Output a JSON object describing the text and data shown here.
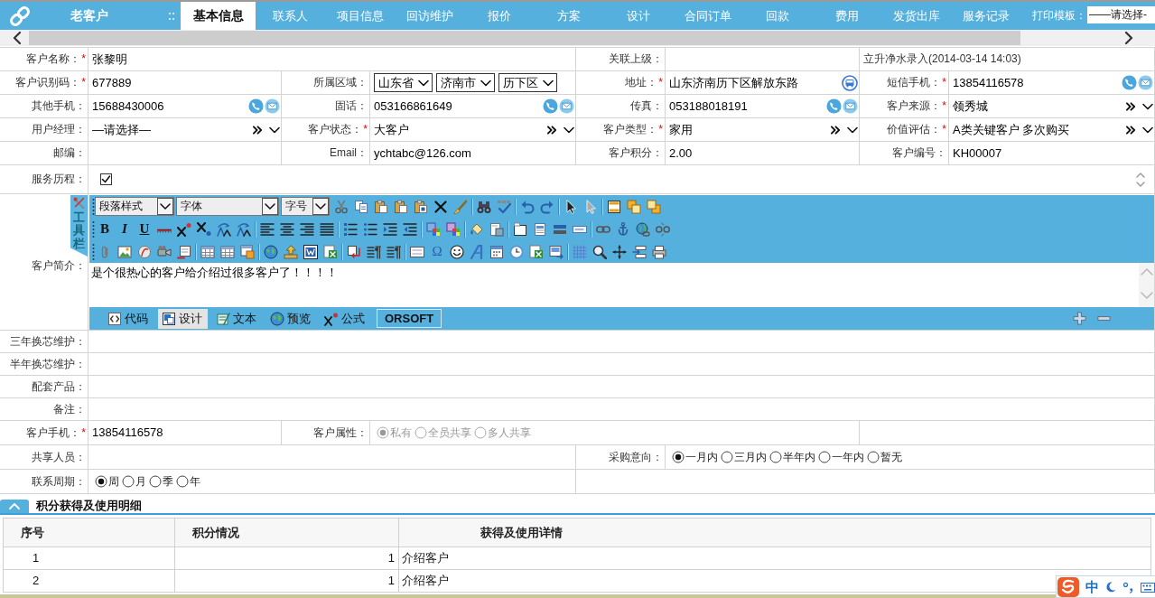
{
  "header": {
    "title": "老客户",
    "tabs": [
      {
        "label": "基本信息",
        "selected": true
      },
      {
        "label": "联系人",
        "selected": false
      },
      {
        "label": "项目信息",
        "selected": false
      },
      {
        "label": "回访维护",
        "selected": false
      },
      {
        "label": "报价",
        "selected": false
      },
      {
        "label": "方案",
        "selected": false
      },
      {
        "label": "设计",
        "selected": false
      },
      {
        "label": "合同订单",
        "selected": false
      },
      {
        "label": "回款",
        "selected": false
      },
      {
        "label": "费用",
        "selected": false
      },
      {
        "label": "发货出库",
        "selected": false
      },
      {
        "label": "服务记录",
        "selected": false
      }
    ],
    "print_template": {
      "label": "打印模板：",
      "value": "——请选择-"
    }
  },
  "form": {
    "rows": [
      [
        {
          "kind": "text",
          "label": "客户名称：",
          "required_mark": "*",
          "value": "张黎明"
        },
        "",
        {
          "kind": "text",
          "label": "关联上级："
        },
        {
          "kind": "note",
          "value": "立升净水录入(2014-03-14 14:03)"
        }
      ],
      [
        {
          "kind": "text",
          "label": "客户识别码：",
          "required_mark": "*",
          "value": "677889"
        },
        {
          "kind": "region",
          "label": "所属区域：",
          "selects": [
            "山东省",
            "济南市",
            "历下区"
          ]
        },
        {
          "kind": "address",
          "label": "地址：",
          "required_mark": "*",
          "value": "山东济南历下区解放东路"
        },
        {
          "kind": "phone",
          "label": "短信手机：",
          "required_mark": "*",
          "value": "13854116578"
        }
      ],
      [
        {
          "kind": "phone",
          "label": "其他手机：",
          "value": "15688430006"
        },
        {
          "kind": "phone",
          "label": "固话：",
          "value": "053166861649"
        },
        {
          "kind": "phone",
          "label": "传真：",
          "value": "053188018191"
        },
        {
          "kind": "select",
          "label": "客户来源：",
          "required_mark": "*",
          "value": "领秀城"
        }
      ],
      [
        {
          "kind": "select",
          "label": "用户经理：",
          "value": "—请选择—"
        },
        {
          "kind": "select",
          "label": "客户状态：",
          "required_mark": "*",
          "value": "大客户"
        },
        {
          "kind": "select",
          "label": "客户类型：",
          "required_mark": "*",
          "value": "家用"
        },
        {
          "kind": "select",
          "label": "价值评估：",
          "required_mark": "*",
          "value": "A类关键客户 多次购买"
        }
      ],
      [
        {
          "kind": "text",
          "label": "邮编："
        },
        {
          "kind": "text",
          "label": "Email：",
          "value": "ychtabc@126.com"
        },
        {
          "kind": "text",
          "label": "客户积分：",
          "value": "2.00"
        },
        {
          "kind": "text",
          "label": "客户编号：",
          "value": "KH00007"
        }
      ],
      [
        {
          "kind": "checkbox",
          "label": "服务历程：",
          "checked": true
        }
      ],
      [
        {
          "kind": "editor",
          "label": "客户简介：",
          "toolbar_label": "工具栏",
          "selects": [
            "段落样式",
            "字体",
            "字号"
          ],
          "letters": [
            "B",
            "I",
            "U"
          ],
          "symbol": "Ω",
          "content": "是个很热心的客户给介绍过很多客户了！！！！",
          "modes": [
            {
              "label": "代码",
              "selected": false
            },
            {
              "label": "设计",
              "selected": true
            },
            {
              "label": "文本",
              "selected": false
            },
            {
              "label": "预览",
              "selected": false
            },
            {
              "label": "公式",
              "selected": false
            }
          ],
          "brand": "ORSOFT"
        }
      ],
      [
        {
          "kind": "text",
          "label": "三年换芯维护："
        }
      ],
      [
        {
          "kind": "text",
          "label": "半年换芯维护："
        }
      ],
      [
        {
          "kind": "text",
          "label": "配套产品："
        }
      ],
      [
        {
          "kind": "text",
          "label": "备注："
        }
      ],
      [
        {
          "kind": "text",
          "label": "客户手机：",
          "required_mark": "*",
          "value": "13854116578"
        },
        {
          "kind": "radios",
          "label": "客户属性：",
          "disabled": true,
          "options": [
            {
              "label": "私有",
              "selected": true
            },
            {
              "label": "全员共享",
              "selected": false
            },
            {
              "label": "多人共享",
              "selected": false
            }
          ]
        },
        ""
      ],
      [
        {
          "kind": "text",
          "label": "共享人员："
        },
        "",
        {
          "kind": "radios",
          "label": "采购意向：",
          "disabled": false,
          "options": [
            {
              "label": "一月内",
              "selected": true
            },
            {
              "label": "三月内",
              "selected": false
            },
            {
              "label": "半年内",
              "selected": false
            },
            {
              "label": "一年内",
              "selected": false
            },
            {
              "label": "暂无",
              "selected": false
            }
          ]
        },
        ""
      ],
      [
        {
          "kind": "radios",
          "label": "联系周期：",
          "disabled": false,
          "options": [
            {
              "label": "周",
              "selected": true
            },
            {
              "label": "月",
              "selected": false
            },
            {
              "label": "季",
              "selected": false
            },
            {
              "label": "年",
              "selected": false
            }
          ]
        },
        ""
      ]
    ]
  },
  "section": {
    "title": "积分获得及使用明细",
    "expanded": true
  },
  "table": {
    "columns": [
      "序号",
      "积分情况",
      "获得及使用详情"
    ],
    "rows": [
      [
        "1",
        "1",
        "介绍客户"
      ],
      [
        "2",
        "1",
        "介绍客户"
      ]
    ]
  },
  "ime": {
    "mode": "中"
  }
}
